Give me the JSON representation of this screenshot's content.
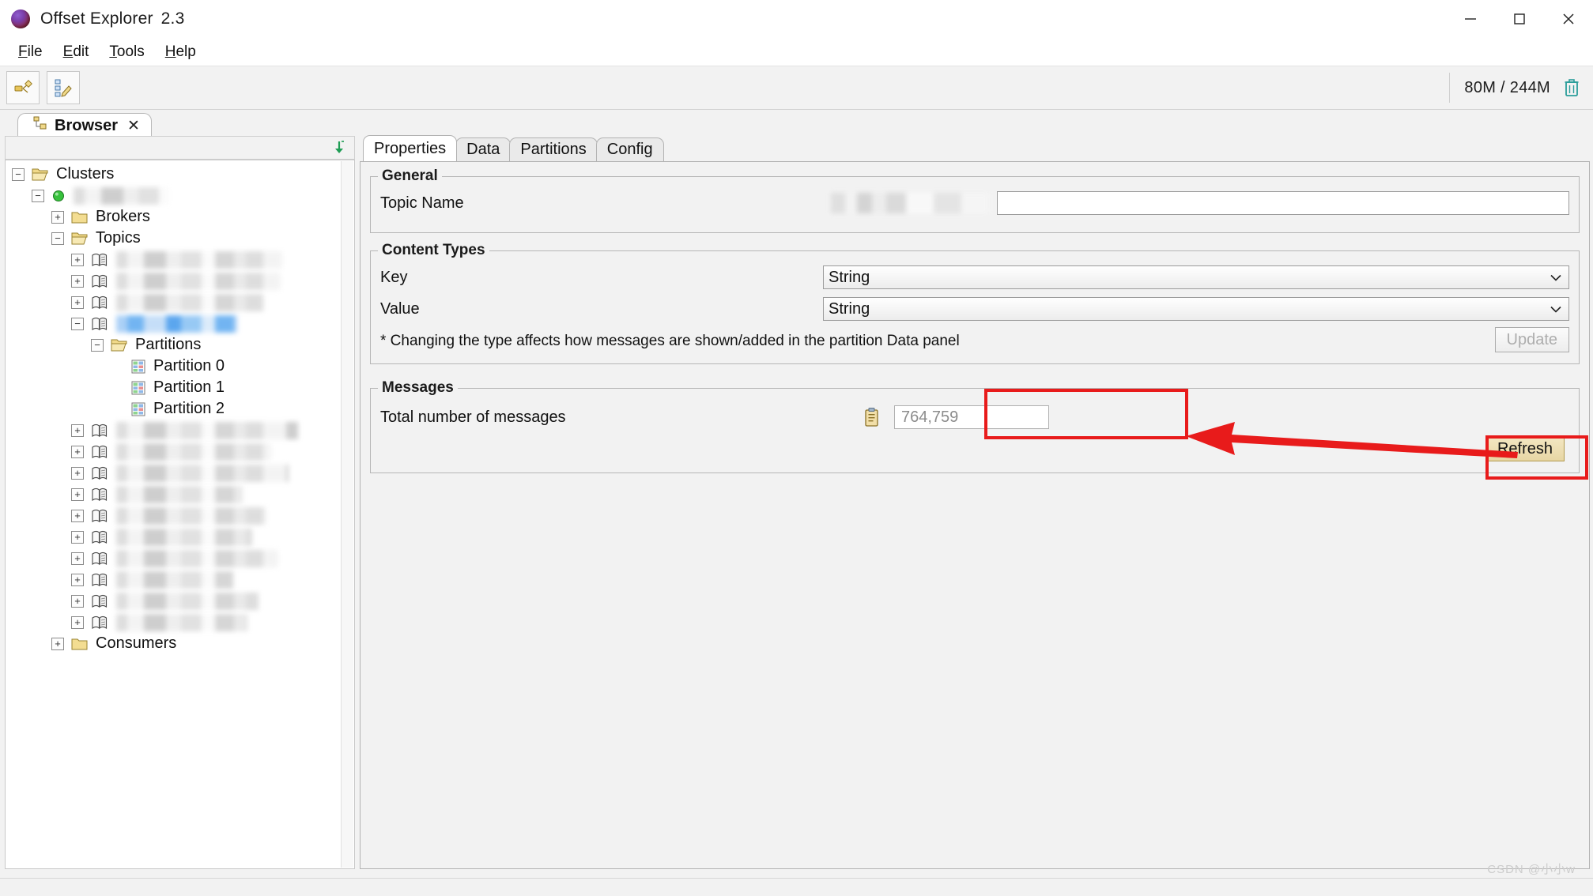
{
  "window": {
    "title": "Offset Explorer",
    "version": "2.3",
    "app_icon": "globe-icon",
    "controls": {
      "minimize": "minimize-icon",
      "maximize": "maximize-icon",
      "close": "close-icon"
    }
  },
  "menubar": {
    "items": [
      {
        "label": "File",
        "mnemonic": "F"
      },
      {
        "label": "Edit",
        "mnemonic": "E"
      },
      {
        "label": "Tools",
        "mnemonic": "T"
      },
      {
        "label": "Help",
        "mnemonic": "H"
      }
    ]
  },
  "toolbar": {
    "buttons": [
      {
        "name": "add-cluster-icon"
      },
      {
        "name": "edit-cluster-icon"
      }
    ],
    "memory": {
      "used": "80M",
      "separator": "/",
      "total": "244M",
      "text": "80M / 244M",
      "gc_icon": "trash-icon",
      "gc_color": "#2a9d9a"
    }
  },
  "tabstrip": {
    "tabs": [
      {
        "label": "Browser",
        "icon": "browser-tree-icon",
        "close": "✕",
        "active": true
      }
    ]
  },
  "tree": {
    "collapse_all_icon": "collapse-all-icon",
    "nodes": [
      {
        "label": "Clusters",
        "icon": "folder-open-icon",
        "state": "expanded",
        "depth": 0
      },
      {
        "label": "",
        "icon": "green-status-dot",
        "state": "expanded",
        "depth": 1,
        "masked": true,
        "mask_width": 120
      },
      {
        "label": "Brokers",
        "icon": "folder-closed-icon",
        "state": "collapsed",
        "depth": 2
      },
      {
        "label": "Topics",
        "icon": "folder-open-icon",
        "state": "expanded",
        "depth": 2
      },
      {
        "label": "",
        "icon": "topic-icon",
        "state": "collapsed",
        "depth": 3,
        "masked": true,
        "mask_width": 210
      },
      {
        "label": "",
        "icon": "topic-icon",
        "state": "collapsed",
        "depth": 3,
        "masked": true,
        "mask_width": 208
      },
      {
        "label": "",
        "icon": "topic-icon",
        "state": "collapsed",
        "depth": 3,
        "masked": true,
        "mask_width": 186
      },
      {
        "label": "",
        "icon": "topic-icon",
        "state": "expanded",
        "depth": 3,
        "masked": true,
        "mask_width": 153,
        "selected": true
      },
      {
        "label": "Partitions",
        "icon": "folder-open-icon",
        "state": "expanded",
        "depth": 4
      },
      {
        "label": "Partition 0",
        "icon": "partition-icon",
        "state": "leaf",
        "depth": 5
      },
      {
        "label": "Partition 1",
        "icon": "partition-icon",
        "state": "leaf",
        "depth": 5
      },
      {
        "label": "Partition 2",
        "icon": "partition-icon",
        "state": "leaf",
        "depth": 5
      },
      {
        "label": "",
        "icon": "topic-icon",
        "state": "collapsed",
        "depth": 3,
        "masked": true,
        "mask_width": 230
      },
      {
        "label": "",
        "icon": "topic-icon",
        "state": "collapsed",
        "depth": 3,
        "masked": true,
        "mask_width": 196
      },
      {
        "label": "",
        "icon": "topic-icon",
        "state": "collapsed",
        "depth": 3,
        "masked": true,
        "mask_width": 218
      },
      {
        "label": "",
        "icon": "topic-icon",
        "state": "collapsed",
        "depth": 3,
        "masked": true,
        "mask_width": 160
      },
      {
        "label": "",
        "icon": "topic-icon",
        "state": "collapsed",
        "depth": 3,
        "masked": true,
        "mask_width": 190
      },
      {
        "label": "",
        "icon": "topic-icon",
        "state": "collapsed",
        "depth": 3,
        "masked": true,
        "mask_width": 172
      },
      {
        "label": "",
        "icon": "topic-icon",
        "state": "collapsed",
        "depth": 3,
        "masked": true,
        "mask_width": 205
      },
      {
        "label": "",
        "icon": "topic-icon",
        "state": "collapsed",
        "depth": 3,
        "masked": true,
        "mask_width": 148
      },
      {
        "label": "",
        "icon": "topic-icon",
        "state": "collapsed",
        "depth": 3,
        "masked": true,
        "mask_width": 180
      },
      {
        "label": "",
        "icon": "topic-icon",
        "state": "collapsed",
        "depth": 3,
        "masked": true,
        "mask_width": 166
      },
      {
        "label": "Consumers",
        "icon": "folder-closed-icon",
        "state": "collapsed",
        "depth": 2
      }
    ]
  },
  "details": {
    "tabs": [
      {
        "label": "Properties",
        "active": true
      },
      {
        "label": "Data",
        "active": false
      },
      {
        "label": "Partitions",
        "active": false
      },
      {
        "label": "Config",
        "active": false
      }
    ],
    "general": {
      "legend": "General",
      "topic_name_label": "Topic Name",
      "topic_name_value": "",
      "topic_name_masked": true
    },
    "content_types": {
      "legend": "Content Types",
      "key_label": "Key",
      "key_value": "String",
      "value_label": "Value",
      "value_value": "String",
      "note": "* Changing the type affects how messages are shown/added in the partition Data panel",
      "update_label": "Update",
      "update_disabled": true
    },
    "messages": {
      "legend": "Messages",
      "total_label": "Total number of messages",
      "total_value": "764,759",
      "copy_icon": "clipboard-icon",
      "refresh_label": "Refresh"
    }
  },
  "annotations": {
    "highlight_color": "#e81b1b",
    "boxes": [
      {
        "name": "total-messages-highlight"
      },
      {
        "name": "refresh-button-highlight"
      }
    ],
    "arrow": {
      "name": "pointer-arrow",
      "from": "refresh-button",
      "to": "total-messages-field"
    }
  },
  "watermark": {
    "text": "CSDN @小小w"
  }
}
